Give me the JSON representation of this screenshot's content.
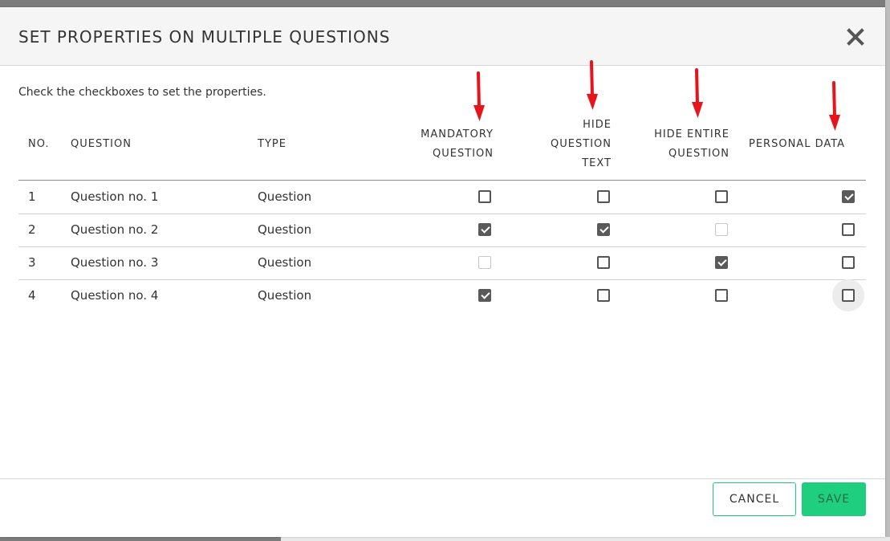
{
  "dialog": {
    "title": "SET PROPERTIES ON MULTIPLE QUESTIONS",
    "intro": "Check the checkboxes to set the properties."
  },
  "columns": {
    "no": "NO.",
    "question": "QUESTION",
    "type": "TYPE",
    "mandatory_line1": "MANDATORY",
    "mandatory_line2": "QUESTION",
    "hide_text_line1": "HIDE",
    "hide_text_line2": "QUESTION",
    "hide_text_line3": "TEXT",
    "hide_entire_line1": "HIDE ENTIRE",
    "hide_entire_line2": "QUESTION",
    "personal_data": "PERSONAL DATA"
  },
  "rows": [
    {
      "no": "1",
      "question": "Question no. 1",
      "type": "Question",
      "mandatory": "unchecked",
      "hide_text": "unchecked",
      "hide_entire": "unchecked",
      "personal_data": "checked"
    },
    {
      "no": "2",
      "question": "Question no. 2",
      "type": "Question",
      "mandatory": "checked",
      "hide_text": "checked",
      "hide_entire": "disabled",
      "personal_data": "unchecked"
    },
    {
      "no": "3",
      "question": "Question no. 3",
      "type": "Question",
      "mandatory": "disabled",
      "hide_text": "unchecked",
      "hide_entire": "checked",
      "personal_data": "unchecked"
    },
    {
      "no": "4",
      "question": "Question no. 4",
      "type": "Question",
      "mandatory": "checked",
      "hide_text": "unchecked",
      "hide_entire": "unchecked",
      "personal_data": "unchecked"
    }
  ],
  "footer": {
    "cancel_label": "CANCEL",
    "save_label": "SAVE"
  },
  "colors": {
    "accent": "#1fcf7f",
    "annotation_arrow": "#e8141b",
    "checkbox_checked": "#5a5a5a"
  },
  "icons": {
    "close": "close-icon",
    "annotation": "red-arrow-annotation"
  }
}
